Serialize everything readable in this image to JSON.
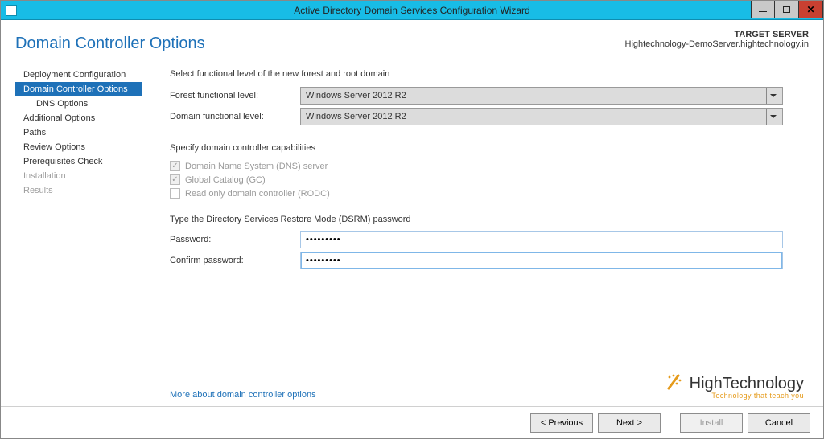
{
  "window": {
    "title": "Active Directory Domain Services Configuration Wizard"
  },
  "header": {
    "page_title": "Domain Controller Options",
    "target_label": "TARGET SERVER",
    "target_value": "Hightechnology-DemoServer.hightechnology.in"
  },
  "sidebar": {
    "items": [
      {
        "label": "Deployment Configuration",
        "state": "normal"
      },
      {
        "label": "Domain Controller Options",
        "state": "selected"
      },
      {
        "label": "DNS Options",
        "state": "normal",
        "sub": true
      },
      {
        "label": "Additional Options",
        "state": "normal"
      },
      {
        "label": "Paths",
        "state": "normal"
      },
      {
        "label": "Review Options",
        "state": "normal"
      },
      {
        "label": "Prerequisites Check",
        "state": "normal"
      },
      {
        "label": "Installation",
        "state": "disabled"
      },
      {
        "label": "Results",
        "state": "disabled"
      }
    ]
  },
  "main": {
    "intro": "Select functional level of the new forest and root domain",
    "forest_label": "Forest functional level:",
    "forest_value": "Windows Server 2012 R2",
    "domain_label": "Domain functional level:",
    "domain_value": "Windows Server 2012 R2",
    "capabilities_head": "Specify domain controller capabilities",
    "cb_dns": "Domain Name System (DNS) server",
    "cb_gc": "Global Catalog (GC)",
    "cb_rodc": "Read only domain controller (RODC)",
    "dsrm_head": "Type the Directory Services Restore Mode (DSRM) password",
    "password_label": "Password:",
    "password_value": "●●●●●●●●●",
    "confirm_label": "Confirm password:",
    "confirm_value": "●●●●●●●●●",
    "more_link": "More about domain controller options"
  },
  "logo": {
    "main": "HighTechnology",
    "sub": "Technology that teach you"
  },
  "footer": {
    "previous": "< Previous",
    "next": "Next >",
    "install": "Install",
    "cancel": "Cancel"
  }
}
